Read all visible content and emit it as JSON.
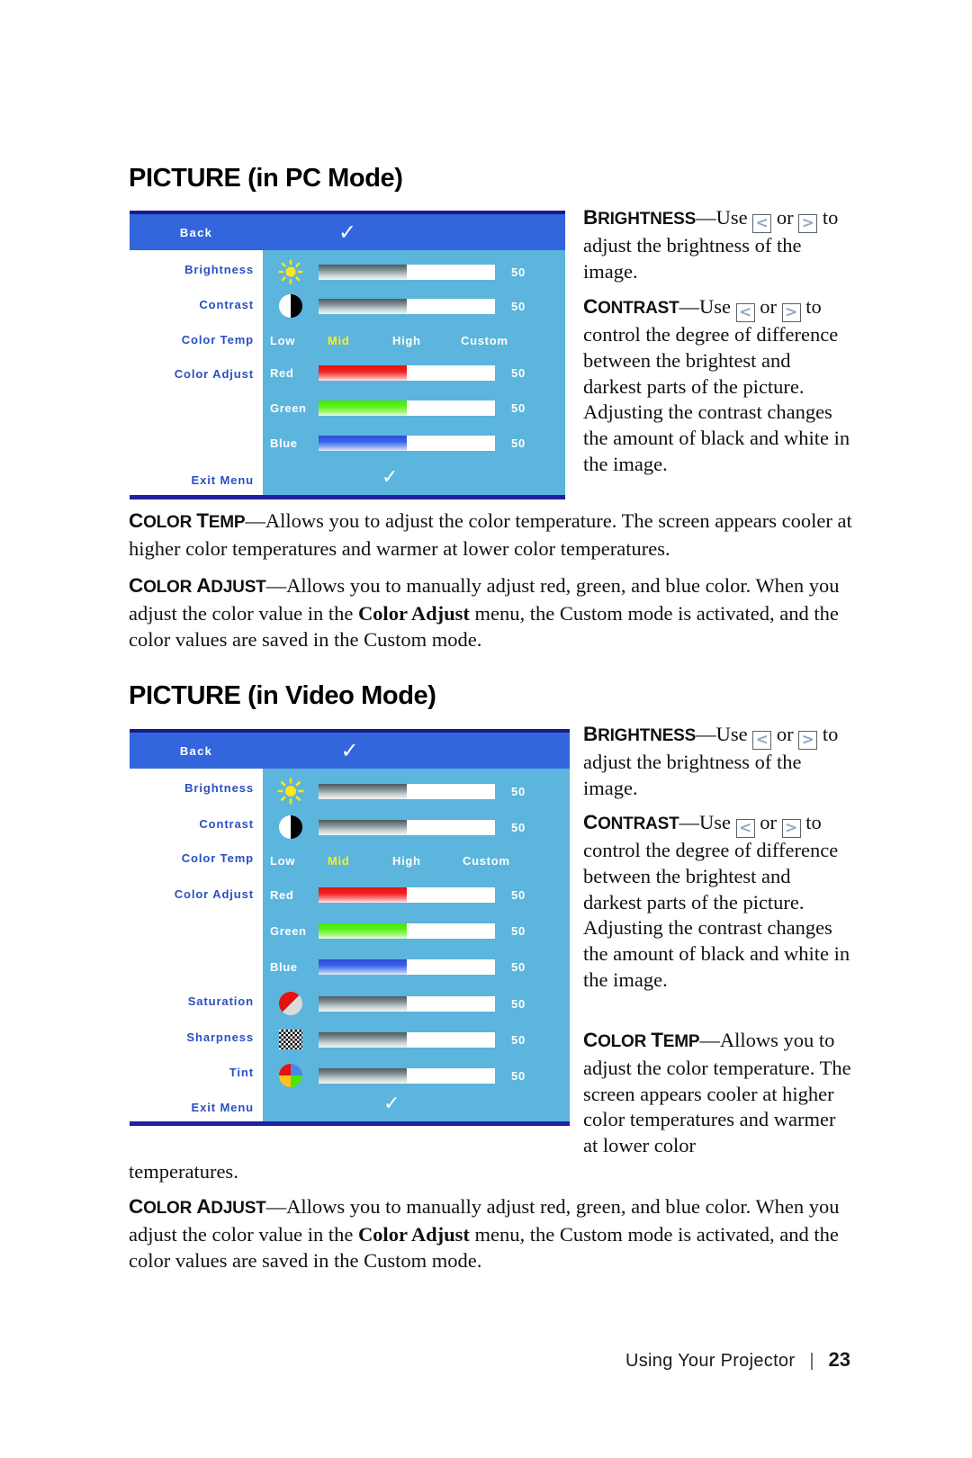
{
  "page": {
    "footer_text": "Using Your Projector",
    "footer_separator": "|",
    "page_number": "23"
  },
  "colors": {
    "osd_header": "#3366DD",
    "osd_header_border": "#1A1A8C",
    "osd_panel": "#5BB5DC",
    "osd_sidebar": "#FFFFFF",
    "osd_label": "#2A4FC4",
    "osd_selected": "#FFEE22",
    "bar_red": "#E81010",
    "bar_green": "#49E609",
    "bar_blue": "#2A4FD8",
    "bar_gray": "#4C5A5E"
  },
  "section_pc": {
    "heading": "PICTURE (in PC Mode)",
    "osd": {
      "back_label": "Back",
      "confirm_icon": "check-icon",
      "exit_label": "Exit Menu",
      "exit_icon": "check-icon",
      "sidebar": [
        "Brightness",
        "Contrast",
        "Color Temp",
        "Color Adjust"
      ],
      "rows": [
        {
          "label": "Brightness",
          "icon": "sun-icon",
          "value": "50",
          "fill": 50,
          "type": "slider",
          "color": "gray"
        },
        {
          "label": "Contrast",
          "icon": "contrast-icon",
          "value": "50",
          "fill": 50,
          "type": "slider",
          "color": "gray"
        },
        {
          "label": "Color Temp",
          "type": "options",
          "options": [
            "Low",
            "Mid",
            "High",
            "Custom"
          ],
          "selected": "Mid"
        },
        {
          "label": "Red",
          "value": "50",
          "fill": 50,
          "type": "slider",
          "color": "red"
        },
        {
          "label": "Green",
          "value": "50",
          "fill": 50,
          "type": "slider",
          "color": "green"
        },
        {
          "label": "Blue",
          "value": "50",
          "fill": 50,
          "type": "slider",
          "color": "blue"
        }
      ]
    },
    "right_col": {
      "brightness_term": "Brightness",
      "brightness_body_1": "—Use",
      "brightness_or": "or",
      "brightness_body_2": "to adjust the brightness of the image.",
      "contrast_term": "Contrast",
      "contrast_body_1": "—Use",
      "contrast_or": "or",
      "contrast_body_2": "to control the degree of difference between the brightest and darkest parts of the picture. Adjusting the contrast changes the amount of black and white in the image.",
      "arrow_left": "<",
      "arrow_right": ">"
    },
    "paragraphs": [
      {
        "term": "Color Temp",
        "body": "—Allows you to adjust the color temperature. The screen appears cooler at higher color temperatures and warmer at lower color temperatures."
      },
      {
        "term": "Color Adjust",
        "body_1": "—Allows you to manually adjust red, green, and blue color. When you adjust the color value in the ",
        "emphasis": "Color Adjust",
        "body_2": " menu, the Custom mode is activated, and the color values are saved in the Custom mode."
      }
    ]
  },
  "section_video": {
    "heading": "PICTURE (in Video Mode)",
    "osd": {
      "back_label": "Back",
      "confirm_icon": "check-icon",
      "exit_label": "Exit Menu",
      "exit_icon": "check-icon",
      "sidebar": [
        "Brightness",
        "Contrast",
        "Color Temp",
        "Color Adjust",
        "Saturation",
        "Sharpness",
        "Tint"
      ],
      "rows": [
        {
          "label": "Brightness",
          "icon": "sun-icon",
          "value": "50",
          "fill": 50,
          "type": "slider",
          "color": "gray"
        },
        {
          "label": "Contrast",
          "icon": "contrast-icon",
          "value": "50",
          "fill": 50,
          "type": "slider",
          "color": "gray"
        },
        {
          "label": "Color Temp",
          "type": "options",
          "options": [
            "Low",
            "Mid",
            "High",
            "Custom"
          ],
          "selected": "Mid"
        },
        {
          "label": "Red",
          "value": "50",
          "fill": 50,
          "type": "slider",
          "color": "red"
        },
        {
          "label": "Green",
          "value": "50",
          "fill": 50,
          "type": "slider",
          "color": "green"
        },
        {
          "label": "Blue",
          "value": "50",
          "fill": 50,
          "type": "slider",
          "color": "blue"
        },
        {
          "label": "Saturation",
          "icon": "saturation-icon",
          "value": "50",
          "fill": 50,
          "type": "slider",
          "color": "gray"
        },
        {
          "label": "Sharpness",
          "icon": "sharpness-icon",
          "value": "50",
          "fill": 50,
          "type": "slider",
          "color": "gray"
        },
        {
          "label": "Tint",
          "icon": "tint-icon",
          "value": "50",
          "fill": 50,
          "type": "slider",
          "color": "gray"
        }
      ]
    },
    "right_col": {
      "brightness_term": "Brightness",
      "brightness_body_1": "—Use",
      "brightness_or": "or",
      "brightness_body_2": "to adjust the brightness of the image.",
      "contrast_term": "Contrast",
      "contrast_body_1": "—Use",
      "contrast_or": "or",
      "contrast_body_2": "to control the degree of difference between the brightest and darkest parts of the picture. Adjusting the contrast changes the amount of black and white in the image.",
      "colortemp_term": "Color Temp",
      "colortemp_body": "—Allows you to adjust the color temperature. The screen appears cooler at higher color temperatures and warmer at lower color",
      "arrow_left": "<",
      "arrow_right": ">"
    },
    "continuation": "temperatures.",
    "paragraphs": [
      {
        "term": "Color Adjust",
        "body_1": "—Allows you to manually adjust red, green, and blue color. When you adjust the color value in the ",
        "emphasis": "Color Adjust",
        "body_2": " menu, the Custom mode is activated, and the color values are saved in the Custom mode."
      }
    ]
  }
}
